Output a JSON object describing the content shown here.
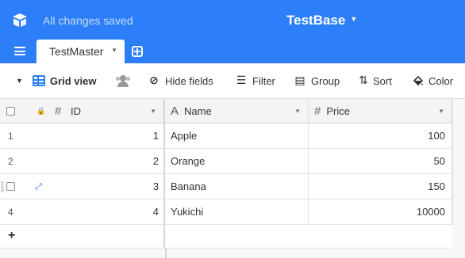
{
  "header": {
    "save_status": "All changes saved",
    "base_name": "TestBase",
    "table_tab": "TestMaster",
    "brand_color": "#2d7ff9"
  },
  "toolbar": {
    "view_name": "Grid view",
    "hide_fields": "Hide fields",
    "filter": "Filter",
    "group": "Group",
    "sort": "Sort",
    "color": "Color"
  },
  "grid": {
    "columns": [
      {
        "label": "ID",
        "icon": "hash-icon"
      },
      {
        "label": "Name",
        "icon": "text-field-icon"
      },
      {
        "label": "Price",
        "icon": "hash-icon"
      }
    ],
    "rows": [
      {
        "num": "1",
        "id": "1",
        "name": "Apple",
        "price": "100"
      },
      {
        "num": "2",
        "id": "2",
        "name": "Orange",
        "price": "50"
      },
      {
        "num": "",
        "id": "3",
        "name": "Banana",
        "price": "150"
      },
      {
        "num": "4",
        "id": "4",
        "name": "Yukichi",
        "price": "10000"
      }
    ],
    "add_row": "+"
  }
}
